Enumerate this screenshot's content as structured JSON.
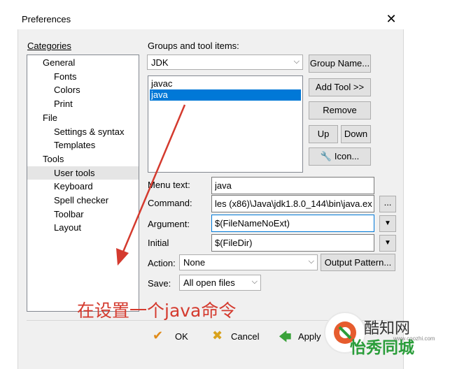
{
  "window": {
    "title": "Preferences",
    "close_glyph": "✕"
  },
  "categories": {
    "label": "Categories",
    "items": [
      {
        "label": "General",
        "level": 0
      },
      {
        "label": "Fonts",
        "level": 1
      },
      {
        "label": "Colors",
        "level": 1
      },
      {
        "label": "Print",
        "level": 1
      },
      {
        "label": "File",
        "level": 0
      },
      {
        "label": "Settings & syntax",
        "level": 1
      },
      {
        "label": "Templates",
        "level": 1
      },
      {
        "label": "Tools",
        "level": 0
      },
      {
        "label": "User tools",
        "level": 1,
        "selected": true
      },
      {
        "label": "Keyboard",
        "level": 1
      },
      {
        "label": "Spell checker",
        "level": 1
      },
      {
        "label": "Toolbar",
        "level": 1
      },
      {
        "label": "Layout",
        "level": 1
      }
    ]
  },
  "groups": {
    "label": "Groups and tool items:",
    "selected_group": "JDK",
    "items": [
      {
        "label": "javac",
        "selected": false
      },
      {
        "label": "java",
        "selected": true
      }
    ]
  },
  "buttons": {
    "group_name": "Group Name...",
    "add_tool": "Add Tool >>",
    "remove": "Remove",
    "up": "Up",
    "down": "Down",
    "icon": "Icon...",
    "browse": "...",
    "output_pattern": "Output Pattern...",
    "ok": "OK",
    "cancel": "Cancel",
    "apply": "Apply"
  },
  "fields": {
    "menu_text_label": "Menu text:",
    "menu_text_value": "java",
    "command_label": "Command:",
    "command_value": "les (x86)\\Java\\jdk1.8.0_144\\bin\\java.exe",
    "argument_label": "Argument:",
    "argument_value": "$(FileNameNoExt)",
    "initial_label": "Initial",
    "initial_value": "$(FileDir)",
    "action_label": "Action:",
    "action_value": "None",
    "save_label": "Save:",
    "save_value": "All open files"
  },
  "annotation": {
    "text": "在设置一个java命令"
  },
  "watermark": {
    "brand1": "酷知网",
    "brand2": "怡秀同城",
    "url": "www.coozhi.com"
  },
  "colors": {
    "selection": "#0078d7",
    "annotation": "#d43a2e",
    "ok_check": "#e08b1a",
    "cancel_x": "#d9a21c",
    "apply_arrow": "#3aa23a"
  }
}
